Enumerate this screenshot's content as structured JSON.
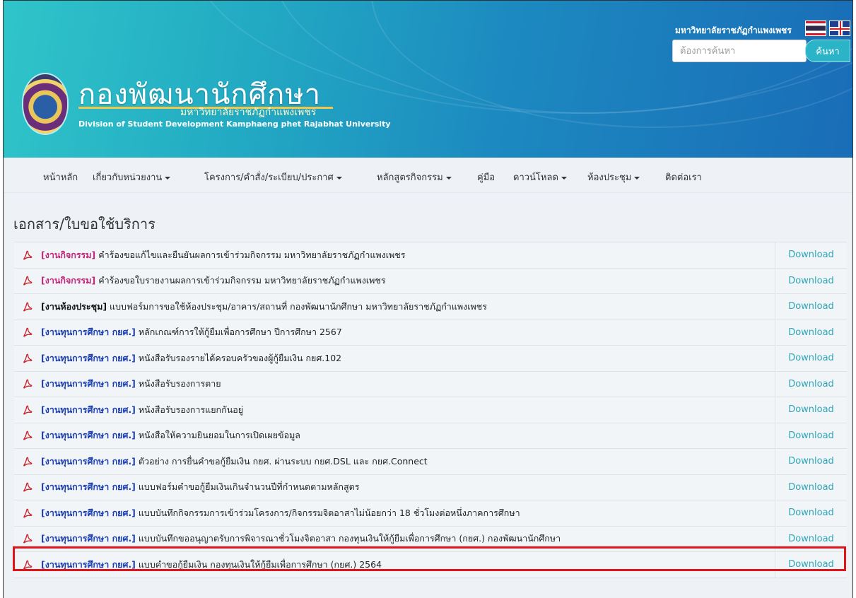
{
  "header": {
    "brand_title": "กองพัฒนานักศึกษา",
    "brand_subtitle": "มหาวิทยาลัยราชภัฏกำแพงเพชร",
    "brand_english": "Division of Student Development Kamphaeng phet Rajabhat University",
    "university_name": "มหาวิทยาลัยราชภัฏกำแพงเพชร",
    "search_placeholder": "ต้องการค้นหา",
    "search_button": "ค้นหา",
    "gradient_colors": [
      "#2fc5c9",
      "#1a6db7"
    ]
  },
  "nav": {
    "items": [
      {
        "label": "หน้าหลัก",
        "dropdown": false
      },
      {
        "label": "เกี่ยวกับหน่วยงาน",
        "dropdown": true
      },
      {
        "label": "โครงการ/คำสั่ง/ระเบียบ/ประกาศ",
        "dropdown": true
      },
      {
        "label": "หลักสูตรกิจกรรม",
        "dropdown": true
      },
      {
        "label": "คู่มือ",
        "dropdown": false
      },
      {
        "label": "ดาวน์โหลด",
        "dropdown": true
      },
      {
        "label": "ห้องประชุม",
        "dropdown": true
      },
      {
        "label": "ติดต่อเรา",
        "dropdown": false
      }
    ]
  },
  "main": {
    "section_title": "เอกสาร/ใบขอใช้บริการ",
    "download_label": "Download",
    "documents": [
      {
        "category": "[งานกิจกรรม]",
        "kind": "activity",
        "title": "คำร้องขอแก้ไขและยืนยันผลการเข้าร่วมกิจกรรม มหาวิทยาลัยราชภัฏกำแพงเพชร"
      },
      {
        "category": "[งานกิจกรรม]",
        "kind": "activity",
        "title": "คำร้องขอใบรายงานผลการเข้าร่วมกิจกรรม มหาวิทยาลัยราชภัฏกำแพงเพชร"
      },
      {
        "category": "[งานห้องประชุม]",
        "kind": "room",
        "title": "แบบฟอร์มการขอใช้ห้องประชุม/อาคาร/สถานที่ กองพัฒนานักศึกษา มหาวิทยาลัยราชภัฏกำแพงเพชร"
      },
      {
        "category": "[งานทุนการศึกษา กยศ.]",
        "kind": "fund",
        "title": "หลักเกณฑ์การให้กู้ยืมเพื่อการศึกษา ปีการศึกษา 2567"
      },
      {
        "category": "[งานทุนการศึกษา กยศ.]",
        "kind": "fund",
        "title": "หนังสือรับรองรายได้ครอบครัวของผู้กู้ยืมเงิน กยศ.102"
      },
      {
        "category": "[งานทุนการศึกษา กยศ.]",
        "kind": "fund",
        "title": "หนังสือรับรองการตาย"
      },
      {
        "category": "[งานทุนการศึกษา กยศ.]",
        "kind": "fund",
        "title": "หนังสือรับรองการแยกกันอยู่"
      },
      {
        "category": "[งานทุนการศึกษา กยศ.]",
        "kind": "fund",
        "title": "หนังสือให้ความยินยอมในการเปิดเผยข้อมูล"
      },
      {
        "category": "[งานทุนการศึกษา กยศ.]",
        "kind": "fund",
        "title": "ตัวอย่าง การยื่นคำขอกู้ยืมเงิน กยศ. ผ่านระบบ กยศ.DSL และ กยศ.Connect"
      },
      {
        "category": "[งานทุนการศึกษา กยศ.]",
        "kind": "fund",
        "title": "แบบฟอร์มคำขอกู้ยืมเงินเกินจำนวนปีที่กำหนดตามหลักสูตร"
      },
      {
        "category": "[งานทุนการศึกษา กยศ.]",
        "kind": "fund",
        "title": "แบบบันทึกกิจกรรมการเข้าร่วมโครงการ/กิจกรรมจิตอาสาไม่น้อยกว่า 18 ชั่วโมงต่อหนึ่งภาคการศึกษา"
      },
      {
        "category": "[งานทุนการศึกษา กยศ.]",
        "kind": "fund",
        "title": "แบบบันทึกขออนุญาตรับการพิจารณาชั่วโมงจิตอาสา กองทุนเงินให้กู้ยืมเพื่อการศึกษา (กยศ.) กองพัฒนานักศึกษา"
      },
      {
        "category": "[งานทุนการศึกษา กยศ.]",
        "kind": "fund",
        "title": "แบบคำขอกู้ยืมเงิน กองทุนเงินให้กู้ยืมเพื่อการศึกษา (กยศ.) 2564"
      }
    ]
  }
}
